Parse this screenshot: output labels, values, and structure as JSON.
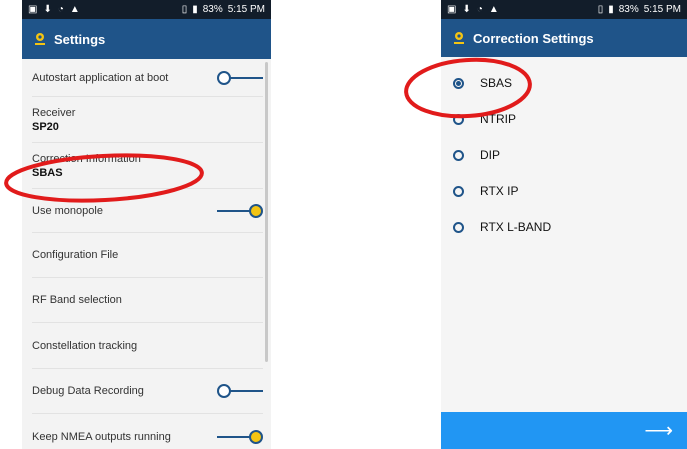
{
  "status_bar": {
    "battery": "83%",
    "time": "5:15 PM"
  },
  "left_screen": {
    "title": "Settings",
    "items": [
      {
        "label": "Autostart application at boot",
        "toggle": "off"
      },
      {
        "label": "Receiver",
        "value": "SP20"
      },
      {
        "label": "Correction Information",
        "value": "SBAS"
      },
      {
        "label": "Use monopole",
        "toggle": "on"
      },
      {
        "label": "Configuration File"
      },
      {
        "label": "RF Band selection"
      },
      {
        "label": "Constellation tracking"
      },
      {
        "label": "Debug Data Recording",
        "toggle": "off"
      },
      {
        "label": "Keep NMEA outputs running",
        "toggle": "on"
      }
    ]
  },
  "right_screen": {
    "title": "Correction Settings",
    "selected_option": "SBAS",
    "options": [
      "SBAS",
      "NTRIP",
      "DIP",
      "RTX IP",
      "RTX L-BAND"
    ]
  },
  "colors": {
    "app_bar": "#1f5489",
    "status_bar": "#121d2a",
    "toggle_on": "#f3c413",
    "bottom_bar": "#2196f3",
    "annotation": "#e11b1b"
  },
  "icons": {
    "app_icon": "location-pin-icon",
    "next": "arrow-right-icon"
  }
}
